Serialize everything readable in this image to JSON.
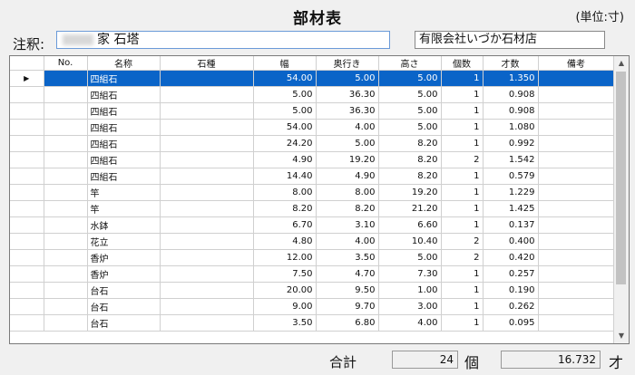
{
  "title": "部材表",
  "unit": "(単位:寸)",
  "note": {
    "label": "注釈:",
    "value": "家 石塔"
  },
  "company": "有限会社いづか石材店",
  "columns": [
    "No.",
    "名称",
    "石種",
    "幅",
    "奥行き",
    "高さ",
    "個数",
    "才数",
    "備考"
  ],
  "rows": [
    {
      "no": "",
      "name": "四組石",
      "stone": "",
      "w": "54.00",
      "d": "5.00",
      "h": "5.00",
      "qty": "1",
      "vol": "1.350",
      "note": ""
    },
    {
      "no": "",
      "name": "四組石",
      "stone": "",
      "w": "5.00",
      "d": "36.30",
      "h": "5.00",
      "qty": "1",
      "vol": "0.908",
      "note": ""
    },
    {
      "no": "",
      "name": "四組石",
      "stone": "",
      "w": "5.00",
      "d": "36.30",
      "h": "5.00",
      "qty": "1",
      "vol": "0.908",
      "note": ""
    },
    {
      "no": "",
      "name": "四組石",
      "stone": "",
      "w": "54.00",
      "d": "4.00",
      "h": "5.00",
      "qty": "1",
      "vol": "1.080",
      "note": ""
    },
    {
      "no": "",
      "name": "四組石",
      "stone": "",
      "w": "24.20",
      "d": "5.00",
      "h": "8.20",
      "qty": "1",
      "vol": "0.992",
      "note": ""
    },
    {
      "no": "",
      "name": "四組石",
      "stone": "",
      "w": "4.90",
      "d": "19.20",
      "h": "8.20",
      "qty": "2",
      "vol": "1.542",
      "note": ""
    },
    {
      "no": "",
      "name": "四組石",
      "stone": "",
      "w": "14.40",
      "d": "4.90",
      "h": "8.20",
      "qty": "1",
      "vol": "0.579",
      "note": ""
    },
    {
      "no": "",
      "name": "竿",
      "stone": "",
      "w": "8.00",
      "d": "8.00",
      "h": "19.20",
      "qty": "1",
      "vol": "1.229",
      "note": ""
    },
    {
      "no": "",
      "name": "竿",
      "stone": "",
      "w": "8.20",
      "d": "8.20",
      "h": "21.20",
      "qty": "1",
      "vol": "1.425",
      "note": ""
    },
    {
      "no": "",
      "name": "水鉢",
      "stone": "",
      "w": "6.70",
      "d": "3.10",
      "h": "6.60",
      "qty": "1",
      "vol": "0.137",
      "note": ""
    },
    {
      "no": "",
      "name": "花立",
      "stone": "",
      "w": "4.80",
      "d": "4.00",
      "h": "10.40",
      "qty": "2",
      "vol": "0.400",
      "note": ""
    },
    {
      "no": "",
      "name": "香炉",
      "stone": "",
      "w": "12.00",
      "d": "3.50",
      "h": "5.00",
      "qty": "2",
      "vol": "0.420",
      "note": ""
    },
    {
      "no": "",
      "name": "香炉",
      "stone": "",
      "w": "7.50",
      "d": "4.70",
      "h": "7.30",
      "qty": "1",
      "vol": "0.257",
      "note": ""
    },
    {
      "no": "",
      "name": "台石",
      "stone": "",
      "w": "20.00",
      "d": "9.50",
      "h": "1.00",
      "qty": "1",
      "vol": "0.190",
      "note": ""
    },
    {
      "no": "",
      "name": "台石",
      "stone": "",
      "w": "9.00",
      "d": "9.70",
      "h": "3.00",
      "qty": "1",
      "vol": "0.262",
      "note": ""
    },
    {
      "no": "",
      "name": "台石",
      "stone": "",
      "w": "3.50",
      "d": "6.80",
      "h": "4.00",
      "qty": "1",
      "vol": "0.095",
      "note": ""
    }
  ],
  "selected_row": 0,
  "totals": {
    "label": "合計",
    "qty": "24",
    "qty_unit": "個",
    "vol": "16.732",
    "vol_unit": "才"
  },
  "colors": {
    "selection": "#0a64c8",
    "note_border": "#6a9ad8"
  }
}
